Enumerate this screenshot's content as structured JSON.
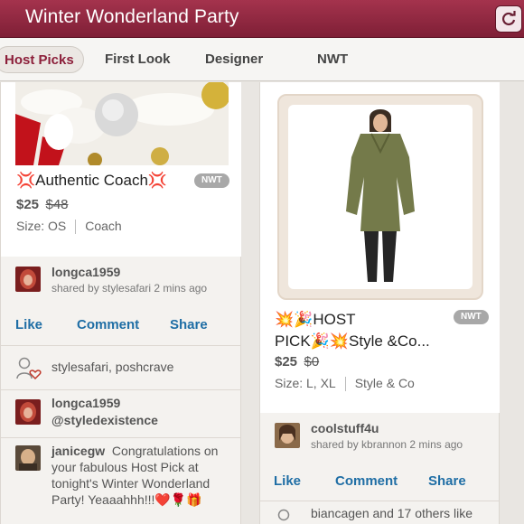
{
  "app": {
    "title": "Winter Wonderland Party",
    "refresh_icon": "refresh-icon"
  },
  "tabs": [
    {
      "label": "Host Picks",
      "active": true
    },
    {
      "label": "First Look",
      "active": false
    },
    {
      "label": "Designer",
      "active": false
    },
    {
      "label": "NWT",
      "active": false
    }
  ],
  "left_card": {
    "title": "💢Authentic Coach💢",
    "badge": "NWT",
    "price": "$25",
    "original_price": "$48",
    "size": "Size: OS",
    "brand": "Coach",
    "poster": {
      "username": "longca1959",
      "shared_by": "shared by stylesafari 2 mins ago"
    },
    "actions": {
      "like": "Like",
      "comment": "Comment",
      "share": "Share"
    },
    "likes_text": "stylesafari, poshcrave",
    "comments": [
      {
        "username": "longca1959",
        "text": "@styledexistence"
      },
      {
        "username": "janicegw",
        "text": "Congratulations on your fabulous Host Pick at tonight's Winter Wonderland Party!  Yeaaahhh!!!❤️🌹🎁"
      }
    ]
  },
  "right_card": {
    "title_line1": "💥🎉HOST",
    "title_line2": "PICK🎉💥Style &Co...",
    "badge": "NWT",
    "price": "$25",
    "original_price": "$0",
    "size": "Size: L, XL",
    "brand": "Style & Co",
    "poster": {
      "username": "coolstuff4u",
      "shared_by": "shared by kbrannon 2 mins ago"
    },
    "actions": {
      "like": "Like",
      "comment": "Comment",
      "share": "Share"
    },
    "likes_text": "biancagen and 17 others like"
  },
  "colors": {
    "brand": "#8c1f3a",
    "action": "#1f6ea5",
    "badge": "#a8a8a8"
  }
}
